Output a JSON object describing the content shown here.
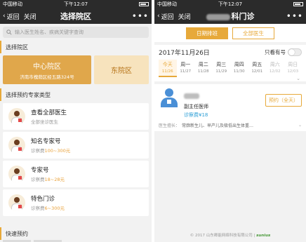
{
  "left": {
    "status": {
      "carrier": "中国移动",
      "time": "下午12:07",
      "battery": ""
    },
    "nav": {
      "back": "返回",
      "close": "关闭",
      "title": "选择院区",
      "more": "•••"
    },
    "search": {
      "placeholder": "输入医生姓名、疾病关键字查询"
    },
    "section_campus": "选择院区",
    "campuses": {
      "main": {
        "name": "中心院区",
        "address": "济南市槐荫区经五路324号"
      },
      "east": {
        "name": "东院区"
      }
    },
    "section_type": "选择预约专家类型",
    "types": [
      {
        "name": "查看全部医生",
        "sub": "全部坐诊医生",
        "fee": ""
      },
      {
        "name": "知名专家号",
        "sub": "诊察费",
        "fee": "100~300元"
      },
      {
        "name": "专家号",
        "sub": "诊察费",
        "fee": "18~28元"
      },
      {
        "name": "特色门诊",
        "sub": "诊察费",
        "fee": "6~300元"
      }
    ],
    "section_quick": "快速预约"
  },
  "right": {
    "status": {
      "carrier": "中国移动",
      "time": "下午12:07"
    },
    "nav": {
      "back": "返回",
      "close": "关闭",
      "title_suffix": "科门诊",
      "more": "•••"
    },
    "tabs": {
      "schedule": "日期排班",
      "all": "全部医生"
    },
    "date": "2017年11月26日",
    "only_available": "只看有号",
    "days": [
      {
        "w": "今天",
        "d": "11/26",
        "state": "today"
      },
      {
        "w": "周一",
        "d": "11/27",
        "state": ""
      },
      {
        "w": "周二",
        "d": "11/28",
        "state": ""
      },
      {
        "w": "周三",
        "d": "11/29",
        "state": ""
      },
      {
        "w": "周四",
        "d": "11/30",
        "state": ""
      },
      {
        "w": "周五",
        "d": "12/01",
        "state": ""
      },
      {
        "w": "周六",
        "d": "12/02",
        "state": "muted"
      },
      {
        "w": "周日",
        "d": "12/03",
        "state": "muted"
      }
    ],
    "doctor": {
      "title": "副主任医师",
      "fee": "诊察费¥18",
      "reserve": "预约（全天）",
      "specialty_label": "医生擅长：",
      "specialty": "常廓新生儿、早产儿及极低出生体重…"
    },
    "copyright": "© 2017 山东卿能网络科技有限公司",
    "logo_text": "sunius"
  }
}
